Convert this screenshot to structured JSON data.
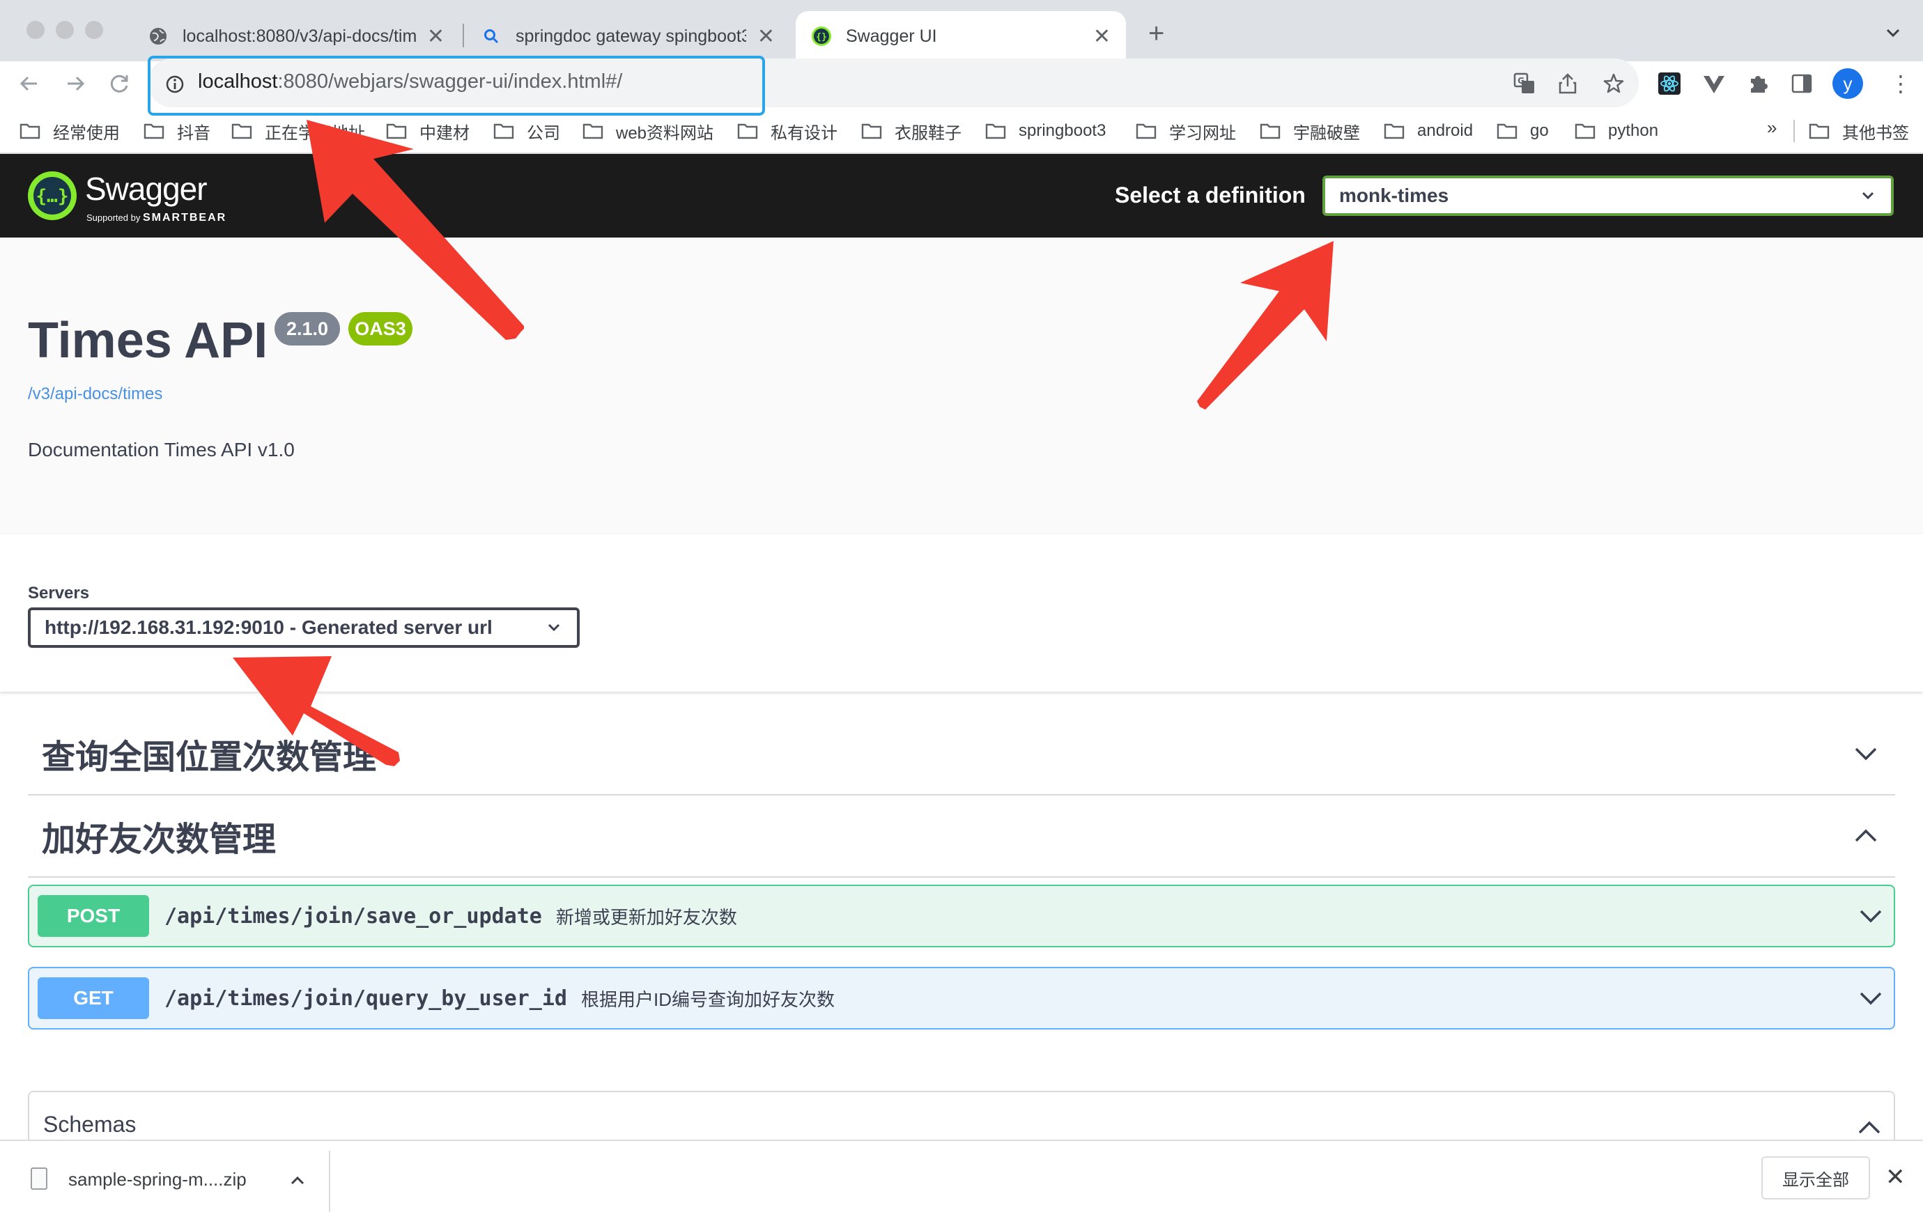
{
  "browser": {
    "tabs": [
      {
        "title": "localhost:8080/v3/api-docs/times",
        "icon": "globe-icon"
      },
      {
        "title": "springdoc gateway spingboot3",
        "icon": "search-icon"
      },
      {
        "title": "Swagger UI",
        "icon": "swagger-icon",
        "active": true
      }
    ],
    "url_host": "localhost",
    "url_rest": ":8080/webjars/swagger-ui/index.html#/",
    "avatar_letter": "y",
    "bookmarks": [
      "经常使用",
      "抖音",
      "正在学习地址",
      "中建材",
      "公司",
      "web资料网站",
      "私有设计",
      "衣服鞋子",
      "springboot3",
      "学习网址",
      "宇融破壁",
      "android",
      "go",
      "python"
    ],
    "bookmarks_more": "»",
    "other_bookmarks": "其他书签"
  },
  "swagger": {
    "logo_text": "Swagger",
    "logo_sub_prefix": "Supported by",
    "logo_sub_brand": "SMARTBEAR",
    "select_definition_label": "Select a definition",
    "selected_definition": "monk-times"
  },
  "info": {
    "title": "Times API",
    "version": "2.1.0",
    "oas_badge": "OAS3",
    "spec_link": "/v3/api-docs/times",
    "description": "Documentation Times API v1.0"
  },
  "servers": {
    "label": "Servers",
    "selected": "http://192.168.31.192:9010 - Generated server url"
  },
  "tags": [
    {
      "name": "查询全国位置次数管理",
      "expanded": false
    },
    {
      "name": "加好友次数管理",
      "expanded": true
    }
  ],
  "operations": [
    {
      "method": "POST",
      "path": "/api/times/join/save_or_update",
      "summary": "新增或更新加好友次数"
    },
    {
      "method": "GET",
      "path": "/api/times/join/query_by_user_id",
      "summary": "根据用户ID编号查询加好友次数"
    }
  ],
  "schemas": {
    "title": "Schemas"
  },
  "downloads": {
    "file_name": "sample-spring-m....zip",
    "show_all": "显示全部"
  },
  "colors": {
    "swagger_green": "#85ea2d",
    "post": "#49cc90",
    "get": "#61affe",
    "annotation_red": "#f23a2f",
    "url_highlight": "#2aa6e8"
  }
}
